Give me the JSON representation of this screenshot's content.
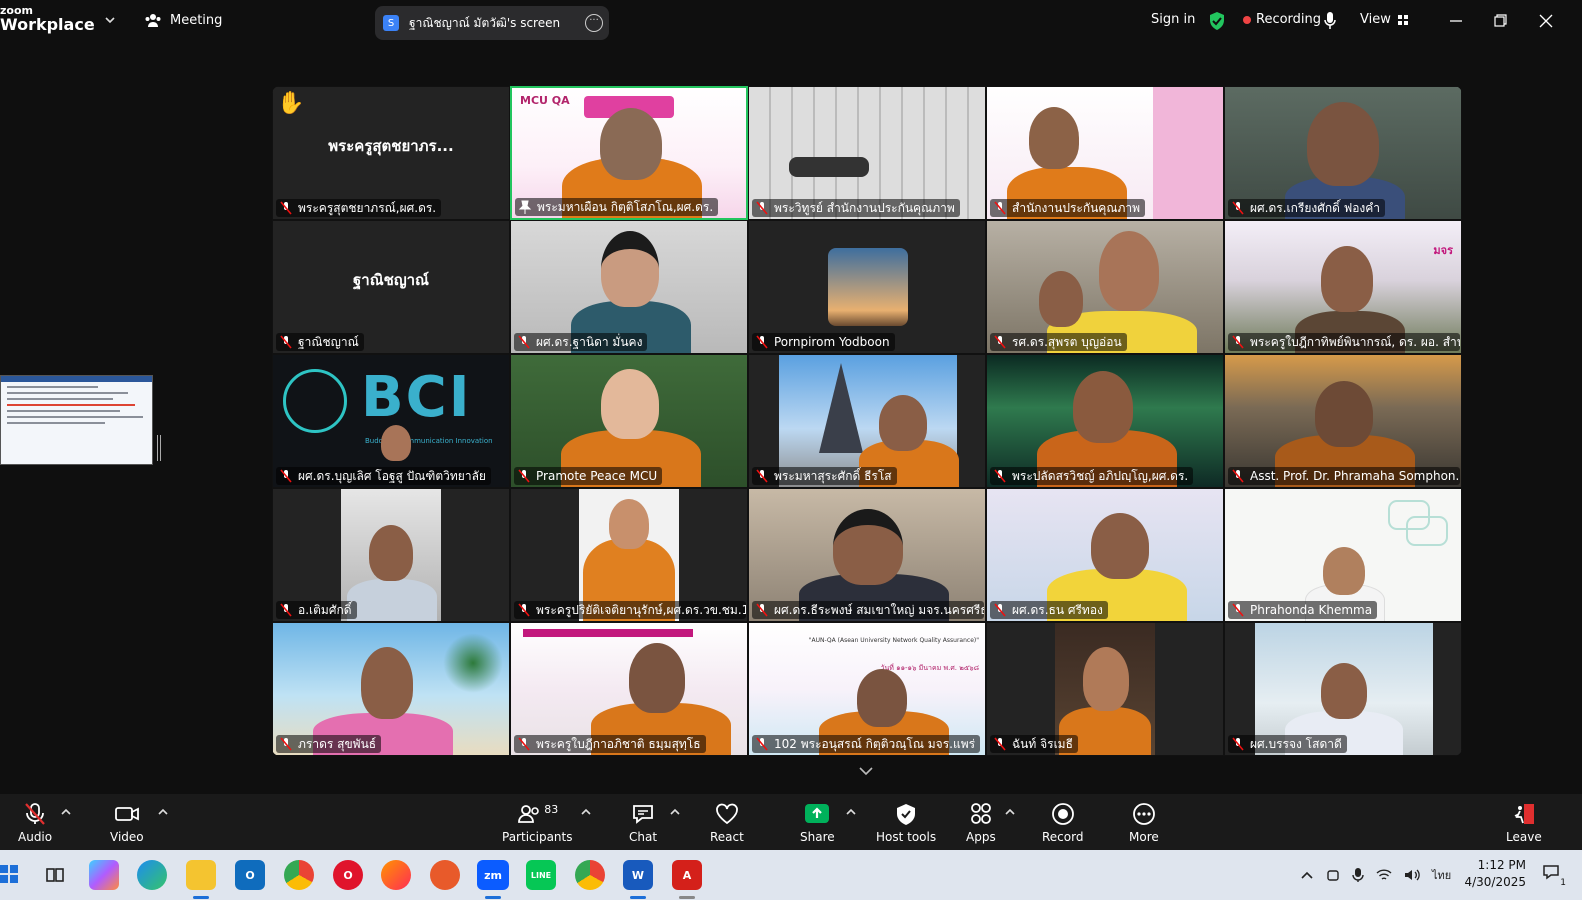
{
  "app": {
    "brand_line1": "zoom",
    "brand_line2": "Workplace"
  },
  "header": {
    "meeting_label": "Meeting",
    "share_title": "ฐาณิชญาณ์ มัตวัฒิ's screen",
    "share_icon_letter": "S",
    "sign_in": "Sign in",
    "recording": "Recording",
    "view": "View"
  },
  "participants": [
    {
      "name": "พระครูสุตชยาภรณ์,ผศ.ดร.",
      "display": "พระครูสุตชยาภร...",
      "muted": true,
      "hand_raised": true,
      "video": false
    },
    {
      "name": "พระมหาเผือน กิตฺติโสภโณ,ผศ.ดร.",
      "muted": false,
      "active": true,
      "pinned": true,
      "video": true
    },
    {
      "name": "พระวิทูรย์ สำนักงานประกันคุณภาพ",
      "muted": true,
      "video": true
    },
    {
      "name": "สำนักงานประกันคุณภาพ",
      "muted": true,
      "video": true
    },
    {
      "name": "ผศ.ดร.เกรียงศักดิ์  ฟองคำ",
      "muted": true,
      "video": true
    },
    {
      "name": "ฐาณิชญาณ์",
      "display": "ฐาณิชญาณ์",
      "muted": true,
      "video": false
    },
    {
      "name": "ผศ.ดร.ฐานิดา มั่นคง",
      "muted": true,
      "video": true
    },
    {
      "name": "Pornpirom Yodboon",
      "muted": true,
      "video": false
    },
    {
      "name": "รศ.ดร.สุพรต บุญอ่อน",
      "muted": true,
      "video": true
    },
    {
      "name": "พระครูใบฎีกาทิพย์พินากรณ์, ดร. ผอ. สำนั...",
      "muted": true,
      "video": true
    },
    {
      "name": "ผศ.ดร.บุญเลิศ โอฐสู ปัณฑิตวิทยาลัย",
      "muted": true,
      "video": true
    },
    {
      "name": "Pramote  Peace  MCU",
      "muted": true,
      "video": true
    },
    {
      "name": "พระมหาสุระศักดิ์ ธีรโส",
      "muted": true,
      "video": true
    },
    {
      "name": "พระปลัดสรวิชญ์  อภิปญฺโญ,ผศ.ดร.",
      "muted": true,
      "video": true
    },
    {
      "name": "Asst. Prof. Dr. Phramaha Somphon...",
      "muted": true,
      "video": true
    },
    {
      "name": "อ.เติมศักดิ์",
      "muted": true,
      "video": true
    },
    {
      "name": "พระครูปริยัติเจติยานุรักษ์,ผศ.ดร.วข.ชม.12...",
      "muted": true,
      "video": true
    },
    {
      "name": "ผศ.ดร.ธีระพงษ์ สมเขาใหญ่ มจร.นครศรีธร...",
      "muted": true,
      "video": true
    },
    {
      "name": "ผศ.ดร.ธน ศรีทอง",
      "muted": true,
      "video": true
    },
    {
      "name": "Phrahonda Khemma",
      "muted": true,
      "video": true
    },
    {
      "name": "ภราดร สุขพันธ์",
      "muted": true,
      "video": true
    },
    {
      "name": "พระครูใบฎีกาอภิชาติ ธมฺมสุทฺโธ",
      "muted": true,
      "video": true
    },
    {
      "name": "102 พระอนุสรณ์ กิตฺติวณฺโณ มจร.แพร่",
      "muted": true,
      "video": true
    },
    {
      "name": "ฉันท์ จิรเมธี",
      "muted": true,
      "video": true
    },
    {
      "name": "ผศ.บรรจง โสดาดี",
      "muted": true,
      "video": true
    }
  ],
  "tile_overlay": {
    "bci_text": "BCI",
    "bci_sub": "Buddhist Communication Innovation",
    "mcu_qa": "MCU QA",
    "aun_qa_1": "\"AUN-QA (Asean University Network Quality Assurance)\"",
    "aun_qa_2": "วันที่ ๑๑-๑๖ มีนาคม พ.ศ. ๒๕๖๘",
    "mjr": "มจร"
  },
  "toolbar": {
    "audio": "Audio",
    "video": "Video",
    "participants": "Participants",
    "participants_count": "83",
    "chat": "Chat",
    "react": "React",
    "share": "Share",
    "host_tools": "Host tools",
    "apps": "Apps",
    "record": "Record",
    "more": "More",
    "leave": "Leave"
  },
  "taskbar": {
    "apps": [
      "windows-start",
      "task-view",
      "copilot",
      "edge",
      "file-explorer",
      "outlook",
      "chrome",
      "opera",
      "firefox",
      "app-orange",
      "zoom",
      "line",
      "chrome-alt",
      "word",
      "acrobat"
    ],
    "zoom_label": "zm",
    "word_label": "W",
    "line_label": "LINE",
    "ime": "ไทย",
    "time": "1:12 PM",
    "date": "4/30/2025",
    "notification_count": "1"
  },
  "colors": {
    "accent_green": "#22c55e",
    "recording_red": "#ef4444",
    "share_green": "#00b15b",
    "leave_red": "#e02f2f"
  }
}
